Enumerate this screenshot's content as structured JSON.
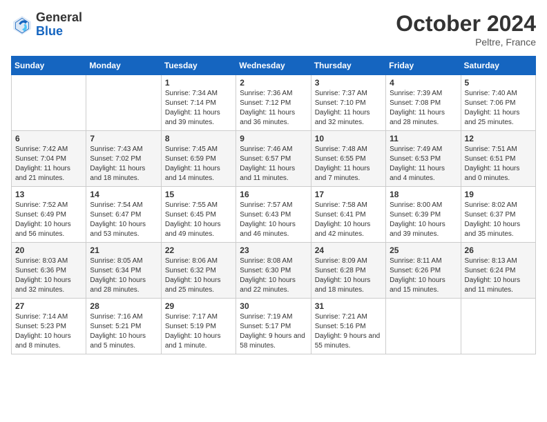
{
  "header": {
    "logo_general": "General",
    "logo_blue": "Blue",
    "month_title": "October 2024",
    "location": "Peltre, France"
  },
  "days_of_week": [
    "Sunday",
    "Monday",
    "Tuesday",
    "Wednesday",
    "Thursday",
    "Friday",
    "Saturday"
  ],
  "weeks": [
    [
      {
        "day": "",
        "info": ""
      },
      {
        "day": "",
        "info": ""
      },
      {
        "day": "1",
        "info": "Sunrise: 7:34 AM\nSunset: 7:14 PM\nDaylight: 11 hours and 39 minutes."
      },
      {
        "day": "2",
        "info": "Sunrise: 7:36 AM\nSunset: 7:12 PM\nDaylight: 11 hours and 36 minutes."
      },
      {
        "day": "3",
        "info": "Sunrise: 7:37 AM\nSunset: 7:10 PM\nDaylight: 11 hours and 32 minutes."
      },
      {
        "day": "4",
        "info": "Sunrise: 7:39 AM\nSunset: 7:08 PM\nDaylight: 11 hours and 28 minutes."
      },
      {
        "day": "5",
        "info": "Sunrise: 7:40 AM\nSunset: 7:06 PM\nDaylight: 11 hours and 25 minutes."
      }
    ],
    [
      {
        "day": "6",
        "info": "Sunrise: 7:42 AM\nSunset: 7:04 PM\nDaylight: 11 hours and 21 minutes."
      },
      {
        "day": "7",
        "info": "Sunrise: 7:43 AM\nSunset: 7:02 PM\nDaylight: 11 hours and 18 minutes."
      },
      {
        "day": "8",
        "info": "Sunrise: 7:45 AM\nSunset: 6:59 PM\nDaylight: 11 hours and 14 minutes."
      },
      {
        "day": "9",
        "info": "Sunrise: 7:46 AM\nSunset: 6:57 PM\nDaylight: 11 hours and 11 minutes."
      },
      {
        "day": "10",
        "info": "Sunrise: 7:48 AM\nSunset: 6:55 PM\nDaylight: 11 hours and 7 minutes."
      },
      {
        "day": "11",
        "info": "Sunrise: 7:49 AM\nSunset: 6:53 PM\nDaylight: 11 hours and 4 minutes."
      },
      {
        "day": "12",
        "info": "Sunrise: 7:51 AM\nSunset: 6:51 PM\nDaylight: 11 hours and 0 minutes."
      }
    ],
    [
      {
        "day": "13",
        "info": "Sunrise: 7:52 AM\nSunset: 6:49 PM\nDaylight: 10 hours and 56 minutes."
      },
      {
        "day": "14",
        "info": "Sunrise: 7:54 AM\nSunset: 6:47 PM\nDaylight: 10 hours and 53 minutes."
      },
      {
        "day": "15",
        "info": "Sunrise: 7:55 AM\nSunset: 6:45 PM\nDaylight: 10 hours and 49 minutes."
      },
      {
        "day": "16",
        "info": "Sunrise: 7:57 AM\nSunset: 6:43 PM\nDaylight: 10 hours and 46 minutes."
      },
      {
        "day": "17",
        "info": "Sunrise: 7:58 AM\nSunset: 6:41 PM\nDaylight: 10 hours and 42 minutes."
      },
      {
        "day": "18",
        "info": "Sunrise: 8:00 AM\nSunset: 6:39 PM\nDaylight: 10 hours and 39 minutes."
      },
      {
        "day": "19",
        "info": "Sunrise: 8:02 AM\nSunset: 6:37 PM\nDaylight: 10 hours and 35 minutes."
      }
    ],
    [
      {
        "day": "20",
        "info": "Sunrise: 8:03 AM\nSunset: 6:36 PM\nDaylight: 10 hours and 32 minutes."
      },
      {
        "day": "21",
        "info": "Sunrise: 8:05 AM\nSunset: 6:34 PM\nDaylight: 10 hours and 28 minutes."
      },
      {
        "day": "22",
        "info": "Sunrise: 8:06 AM\nSunset: 6:32 PM\nDaylight: 10 hours and 25 minutes."
      },
      {
        "day": "23",
        "info": "Sunrise: 8:08 AM\nSunset: 6:30 PM\nDaylight: 10 hours and 22 minutes."
      },
      {
        "day": "24",
        "info": "Sunrise: 8:09 AM\nSunset: 6:28 PM\nDaylight: 10 hours and 18 minutes."
      },
      {
        "day": "25",
        "info": "Sunrise: 8:11 AM\nSunset: 6:26 PM\nDaylight: 10 hours and 15 minutes."
      },
      {
        "day": "26",
        "info": "Sunrise: 8:13 AM\nSunset: 6:24 PM\nDaylight: 10 hours and 11 minutes."
      }
    ],
    [
      {
        "day": "27",
        "info": "Sunrise: 7:14 AM\nSunset: 5:23 PM\nDaylight: 10 hours and 8 minutes."
      },
      {
        "day": "28",
        "info": "Sunrise: 7:16 AM\nSunset: 5:21 PM\nDaylight: 10 hours and 5 minutes."
      },
      {
        "day": "29",
        "info": "Sunrise: 7:17 AM\nSunset: 5:19 PM\nDaylight: 10 hours and 1 minute."
      },
      {
        "day": "30",
        "info": "Sunrise: 7:19 AM\nSunset: 5:17 PM\nDaylight: 9 hours and 58 minutes."
      },
      {
        "day": "31",
        "info": "Sunrise: 7:21 AM\nSunset: 5:16 PM\nDaylight: 9 hours and 55 minutes."
      },
      {
        "day": "",
        "info": ""
      },
      {
        "day": "",
        "info": ""
      }
    ]
  ]
}
